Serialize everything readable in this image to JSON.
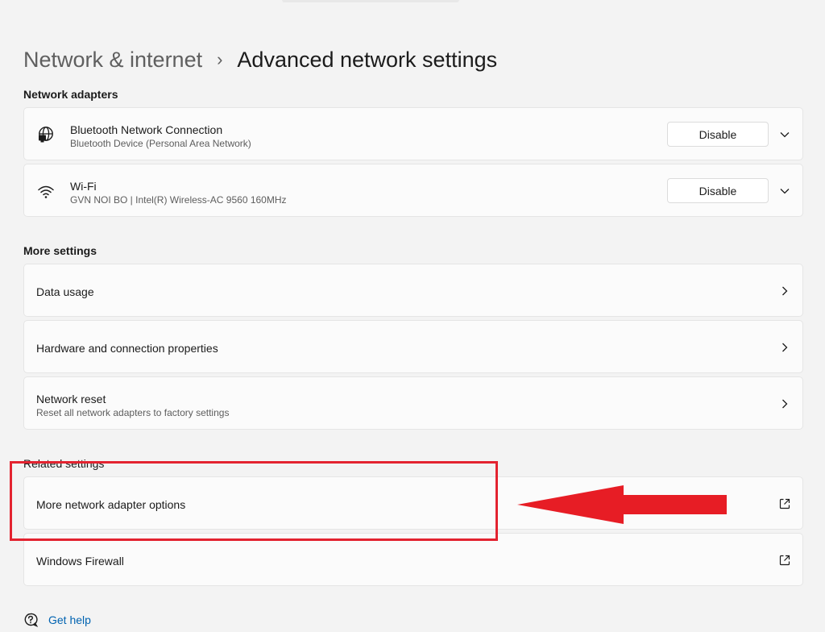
{
  "breadcrumb": {
    "parent": "Network & internet",
    "separator": "›",
    "current": "Advanced network settings"
  },
  "network_adapters": {
    "heading": "Network adapters",
    "items": [
      {
        "name": "Bluetooth Network Connection",
        "description": "Bluetooth Device (Personal Area Network)",
        "button_label": "Disable",
        "icon": "globe-monitor-icon"
      },
      {
        "name": "Wi-Fi",
        "description": "GVN NOI BO | Intel(R) Wireless-AC 9560 160MHz",
        "button_label": "Disable",
        "icon": "wifi-icon"
      }
    ]
  },
  "more_settings": {
    "heading": "More settings",
    "items": [
      {
        "title": "Data usage",
        "icon": "chevron-right-icon"
      },
      {
        "title": "Hardware and connection properties",
        "icon": "chevron-right-icon"
      },
      {
        "title": "Network reset",
        "description": "Reset all network adapters to factory settings",
        "icon": "chevron-right-icon"
      }
    ]
  },
  "related_settings": {
    "heading": "Related settings",
    "items": [
      {
        "title": "More network adapter options",
        "icon": "open-external-icon"
      },
      {
        "title": "Windows Firewall",
        "icon": "open-external-icon"
      }
    ]
  },
  "help": {
    "label": "Get help",
    "icon": "help-chat-icon"
  },
  "annotation": {
    "highlight_color": "#e32330",
    "arrow_color": "#e71d25"
  },
  "colors": {
    "background": "#f3f3f3",
    "card": "#fbfbfb",
    "link": "#0063b1"
  }
}
